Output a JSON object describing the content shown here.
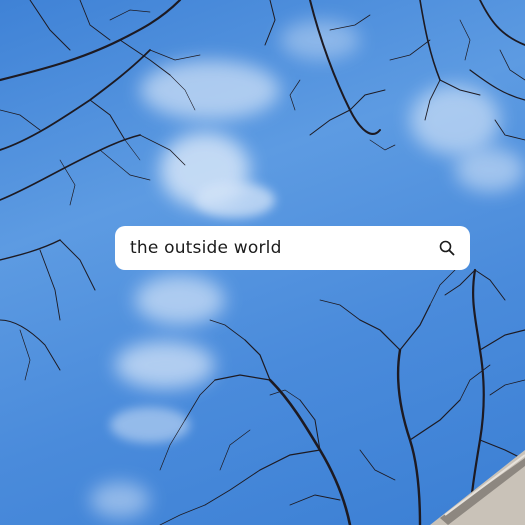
{
  "search": {
    "query": "the outside world",
    "icon": "magnifier"
  },
  "colors": {
    "sky": "#4a8bdb",
    "search_bg": "#ffffff",
    "text": "#1b1b1b",
    "branches": "#1d1a22"
  }
}
